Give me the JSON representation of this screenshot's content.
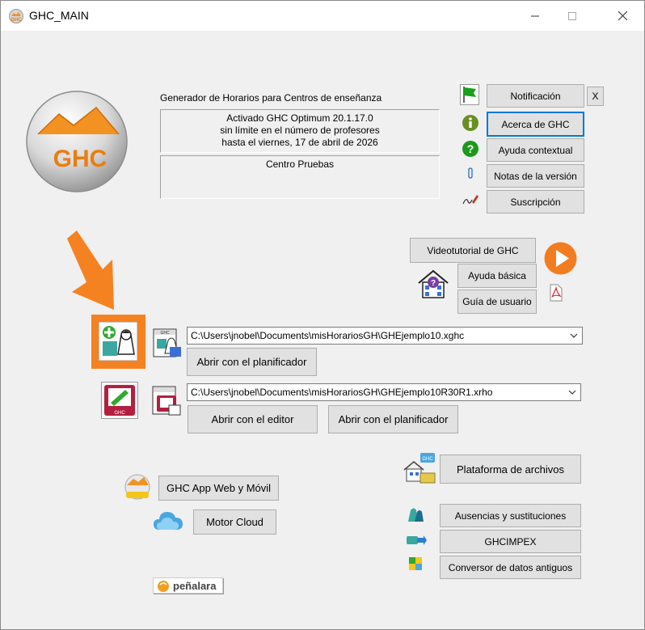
{
  "window": {
    "title": "GHC_MAIN",
    "minimize_icon": "minimize-icon",
    "maximize_icon": "maximize-icon",
    "close_icon": "close-icon"
  },
  "header": {
    "subtitle": "Generador de Horarios para Centros de enseñanza",
    "license": [
      "Activado GHC Optimum 20.1.17.0",
      "sin límite en el número de profesores",
      "hasta el viernes, 17 de abril de 2026"
    ],
    "center": "Centro Pruebas",
    "logo_text": "GHC"
  },
  "right_buttons": {
    "notificacion": "Notificación",
    "close_x": "X",
    "acerca": "Acerca de GHC",
    "ayuda_contextual": "Ayuda contextual",
    "notas": "Notas de la versión",
    "suscripcion": "Suscripción"
  },
  "help": {
    "videotutorial": "Videotutorial de GHC",
    "ayuda_basica": "Ayuda básica",
    "guia": "Guía de usuario"
  },
  "files": {
    "xghc_path": "C:\\Users\\jnobel\\Documents\\misHorariosGH\\GHEjemplo10.xghc",
    "xrho_path": "C:\\Users\\jnobel\\Documents\\misHorariosGH\\GHEjemplo10R30R1.xrho",
    "abrir_planificador_1": "Abrir con el planificador",
    "abrir_editor": "Abrir con el editor",
    "abrir_planificador_2": "Abrir con el planificador"
  },
  "bottom_left": {
    "app_web": "GHC App Web y Móvil",
    "motor_cloud": "Motor Cloud",
    "penalara": "peñalara"
  },
  "bottom_right": {
    "plataforma": "Plataforma de archivos",
    "ausencias": "Ausencias y sustituciones",
    "ghcimpex": "GHCIMPEX",
    "conversor": "Conversor de datos antiguos"
  },
  "colors": {
    "accent_orange": "#f58220",
    "focus_blue": "#0078d7",
    "button_bg": "#e1e1e1"
  }
}
